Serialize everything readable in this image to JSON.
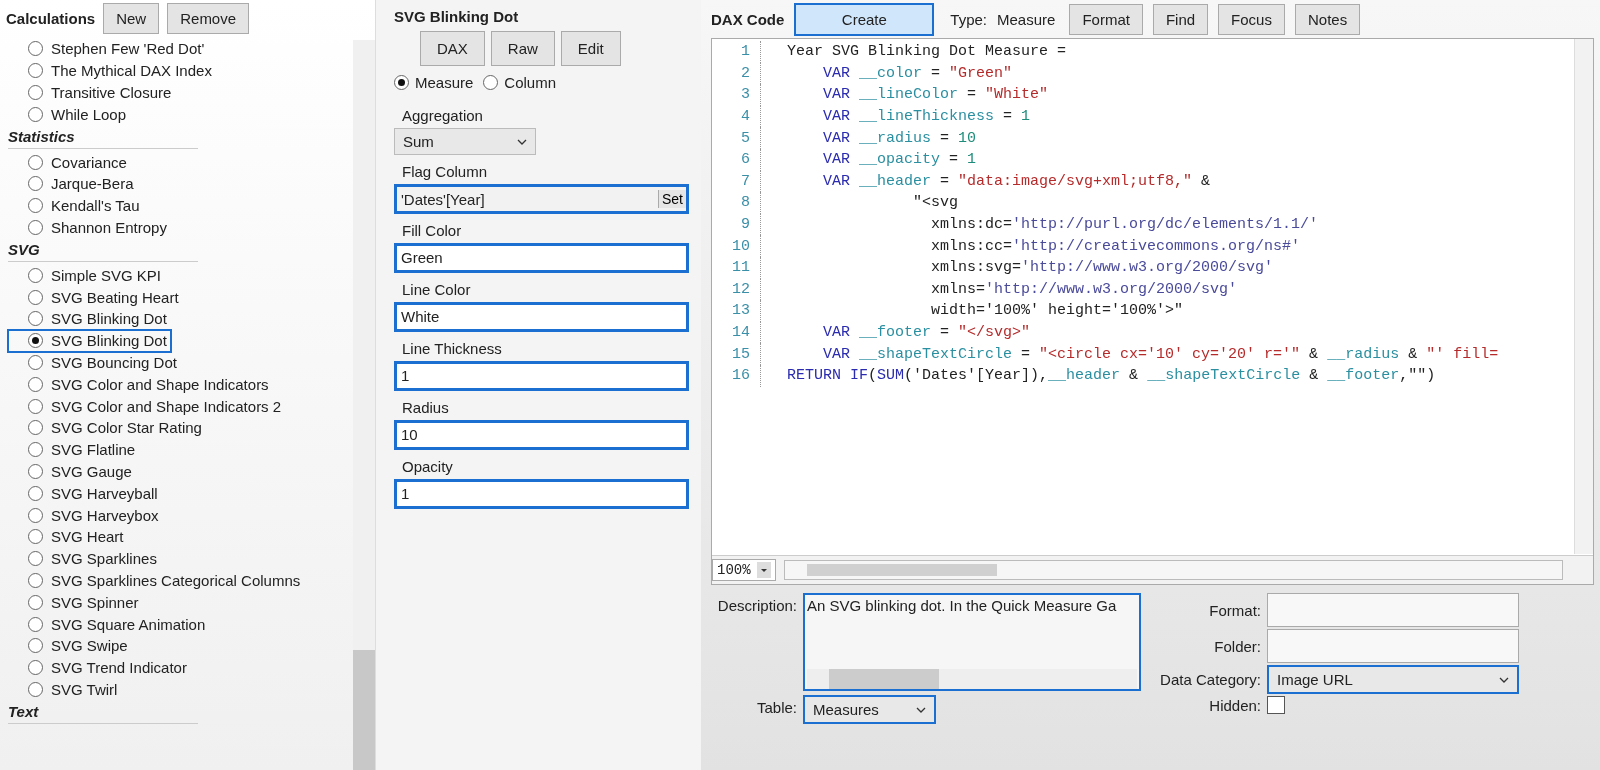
{
  "calculations": {
    "title": "Calculations",
    "buttons": [
      "New",
      "Remove"
    ],
    "groups": [
      {
        "items": [
          {
            "label": "Stephen Few 'Red Dot'",
            "selected": false,
            "highlighted": false
          },
          {
            "label": "The Mythical DAX Index",
            "selected": false,
            "highlighted": false
          },
          {
            "label": "Transitive Closure",
            "selected": false,
            "highlighted": false
          },
          {
            "label": "While Loop",
            "selected": false,
            "highlighted": false
          }
        ]
      },
      {
        "header": "Statistics",
        "items": [
          {
            "label": "Covariance",
            "selected": false,
            "highlighted": false
          },
          {
            "label": "Jarque-Bera",
            "selected": false,
            "highlighted": false
          },
          {
            "label": "Kendall's Tau",
            "selected": false,
            "highlighted": false
          },
          {
            "label": "Shannon Entropy",
            "selected": false,
            "highlighted": false
          }
        ]
      },
      {
        "header": "SVG",
        "items": [
          {
            "label": "Simple SVG KPI",
            "selected": false,
            "highlighted": false
          },
          {
            "label": "SVG Beating Heart",
            "selected": false,
            "highlighted": false
          },
          {
            "label": "SVG Blinking Dot",
            "selected": false,
            "highlighted": false
          },
          {
            "label": "SVG Blinking Dot",
            "selected": true,
            "highlighted": true
          },
          {
            "label": "SVG Bouncing Dot",
            "selected": false,
            "highlighted": false
          },
          {
            "label": "SVG Color and Shape Indicators",
            "selected": false,
            "highlighted": false
          },
          {
            "label": "SVG Color and Shape Indicators 2",
            "selected": false,
            "highlighted": false
          },
          {
            "label": "SVG Color Star Rating",
            "selected": false,
            "highlighted": false
          },
          {
            "label": "SVG Flatline",
            "selected": false,
            "highlighted": false
          },
          {
            "label": "SVG Gauge",
            "selected": false,
            "highlighted": false
          },
          {
            "label": "SVG Harveyball",
            "selected": false,
            "highlighted": false
          },
          {
            "label": "SVG Harveybox",
            "selected": false,
            "highlighted": false
          },
          {
            "label": "SVG Heart",
            "selected": false,
            "highlighted": false
          },
          {
            "label": "SVG Sparklines",
            "selected": false,
            "highlighted": false
          },
          {
            "label": "SVG Sparklines Categorical Columns",
            "selected": false,
            "highlighted": false
          },
          {
            "label": "SVG Spinner",
            "selected": false,
            "highlighted": false
          },
          {
            "label": "SVG Square Animation",
            "selected": false,
            "highlighted": false
          },
          {
            "label": "SVG Swipe",
            "selected": false,
            "highlighted": false
          },
          {
            "label": "SVG Trend Indicator",
            "selected": false,
            "highlighted": false
          },
          {
            "label": "SVG Twirl",
            "selected": false,
            "highlighted": false
          }
        ]
      },
      {
        "header": "Text"
      }
    ]
  },
  "parameters": {
    "title": "SVG Blinking Dot",
    "buttons": [
      "DAX",
      "Raw",
      "Edit"
    ],
    "modes": [
      {
        "label": "Measure",
        "selected": true
      },
      {
        "label": "Column",
        "selected": false
      }
    ],
    "fields": [
      {
        "kind": "dropdown",
        "label": "Aggregation",
        "value": "Sum",
        "highlighted": false
      },
      {
        "kind": "picker",
        "label": "Flag Column",
        "value": "'Dates'[Year]",
        "button": "Set",
        "highlighted": true
      },
      {
        "kind": "text",
        "label": "Fill Color",
        "value": "Green",
        "highlighted": true
      },
      {
        "kind": "text",
        "label": "Line Color",
        "value": "White",
        "highlighted": true
      },
      {
        "kind": "text",
        "label": "Line Thickness",
        "value": "1",
        "highlighted": true
      },
      {
        "kind": "text",
        "label": "Radius",
        "value": "10",
        "highlighted": true
      },
      {
        "kind": "text",
        "label": "Opacity",
        "value": "1",
        "highlighted": true
      }
    ]
  },
  "dax_code": {
    "title": "DAX Code",
    "create_button": "Create",
    "type_label": "Type:",
    "type_value": "Measure",
    "buttons": [
      "Format",
      "Find",
      "Focus",
      "Notes"
    ],
    "lines": [
      {
        "number": "1",
        "kind": "top",
        "tokens": [
          {
            "kind": "plain",
            "text": "Year SVG Blinking Dot Measure ="
          }
        ]
      },
      {
        "number": "2",
        "kind": "var",
        "tokens": [
          {
            "kind": "kw",
            "text": "VAR"
          },
          {
            "kind": "var",
            "text": " __color"
          },
          {
            "kind": "plain",
            "text": " = "
          },
          {
            "kind": "str",
            "text": "\"Green\""
          }
        ]
      },
      {
        "number": "3",
        "kind": "var",
        "tokens": [
          {
            "kind": "kw",
            "text": "VAR"
          },
          {
            "kind": "var",
            "text": " __lineColor"
          },
          {
            "kind": "plain",
            "text": " = "
          },
          {
            "kind": "str",
            "text": "\"White\""
          }
        ]
      },
      {
        "number": "4",
        "kind": "var",
        "tokens": [
          {
            "kind": "kw",
            "text": "VAR"
          },
          {
            "kind": "var",
            "text": " __lineThickness"
          },
          {
            "kind": "plain",
            "text": " = "
          },
          {
            "kind": "num",
            "text": "1"
          }
        ]
      },
      {
        "number": "5",
        "kind": "var",
        "tokens": [
          {
            "kind": "kw",
            "text": "VAR"
          },
          {
            "kind": "var",
            "text": " __radius"
          },
          {
            "kind": "plain",
            "text": " = "
          },
          {
            "kind": "num",
            "text": "10"
          }
        ]
      },
      {
        "number": "6",
        "kind": "var",
        "tokens": [
          {
            "kind": "kw",
            "text": "VAR"
          },
          {
            "kind": "var",
            "text": " __opacity"
          },
          {
            "kind": "plain",
            "text": " = "
          },
          {
            "kind": "num",
            "text": "1"
          }
        ]
      },
      {
        "number": "7",
        "kind": "var",
        "tokens": [
          {
            "kind": "kw",
            "text": "VAR"
          },
          {
            "kind": "var",
            "text": " __header"
          },
          {
            "kind": "plain",
            "text": " = "
          },
          {
            "kind": "str",
            "text": "\"data:image/svg+xml;utf8,\""
          },
          {
            "kind": "plain",
            "text": " &"
          }
        ]
      },
      {
        "number": "8",
        "kind": "cont",
        "tokens": [
          {
            "kind": "plain",
            "text": "\"<svg"
          }
        ]
      },
      {
        "number": "9",
        "kind": "attr",
        "tokens": [
          {
            "kind": "plain",
            "text": "xmlns:dc="
          },
          {
            "kind": "url",
            "text": "'http://purl.org/dc/elements/1.1/'"
          }
        ]
      },
      {
        "number": "10",
        "kind": "attr",
        "tokens": [
          {
            "kind": "plain",
            "text": "xmlns:cc="
          },
          {
            "kind": "url",
            "text": "'http://creativecommons.org/ns#'"
          }
        ]
      },
      {
        "number": "11",
        "kind": "attr",
        "tokens": [
          {
            "kind": "plain",
            "text": "xmlns:svg="
          },
          {
            "kind": "url",
            "text": "'http://www.w3.org/2000/svg'"
          }
        ]
      },
      {
        "number": "12",
        "kind": "attr",
        "tokens": [
          {
            "kind": "plain",
            "text": "xmlns="
          },
          {
            "kind": "url",
            "text": "'http://www.w3.org/2000/svg'"
          }
        ]
      },
      {
        "number": "13",
        "kind": "attr",
        "tokens": [
          {
            "kind": "plain",
            "text": "width='100%' height='100%'>\""
          }
        ]
      },
      {
        "number": "14",
        "kind": "var",
        "tokens": [
          {
            "kind": "kw",
            "text": "VAR"
          },
          {
            "kind": "var",
            "text": " __footer"
          },
          {
            "kind": "plain",
            "text": " = "
          },
          {
            "kind": "str",
            "text": "\"</svg>\""
          }
        ]
      },
      {
        "number": "15",
        "kind": "var",
        "tokens": [
          {
            "kind": "kw",
            "text": "VAR"
          },
          {
            "kind": "var",
            "text": " __shapeTextCircle"
          },
          {
            "kind": "plain",
            "text": " = "
          },
          {
            "kind": "str",
            "text": "\"<circle cx='10' cy='20' r='\""
          },
          {
            "kind": "plain",
            "text": " & "
          },
          {
            "kind": "var",
            "text": "__radius"
          },
          {
            "kind": "plain",
            "text": " & "
          },
          {
            "kind": "str",
            "text": "\"' fill="
          }
        ]
      },
      {
        "number": "16",
        "kind": "top",
        "tokens": [
          {
            "kind": "kw",
            "text": "RETURN"
          },
          {
            "kind": "kw",
            "text": " IF"
          },
          {
            "kind": "plain",
            "text": "("
          },
          {
            "kind": "kw",
            "text": "SUM"
          },
          {
            "kind": "plain",
            "text": "('Dates'[Year]),"
          },
          {
            "kind": "var",
            "text": "__header"
          },
          {
            "kind": "plain",
            "text": " & "
          },
          {
            "kind": "var",
            "text": "__shapeTextCircle"
          },
          {
            "kind": "plain",
            "text": " & "
          },
          {
            "kind": "var",
            "text": "__footer"
          },
          {
            "kind": "plain",
            "text": ",\"\")"
          }
        ]
      }
    ],
    "zoom": "100%"
  },
  "properties": {
    "description_label": "Description:",
    "description": "An SVG blinking dot. In the Quick Measure Ga",
    "table_label": "Table:",
    "table": "Measures",
    "format_label": "Format:",
    "folder_label": "Folder:",
    "data_category_label": "Data Category:",
    "data_category": "Image URL",
    "hidden_label": "Hidden:",
    "hidden": false
  }
}
